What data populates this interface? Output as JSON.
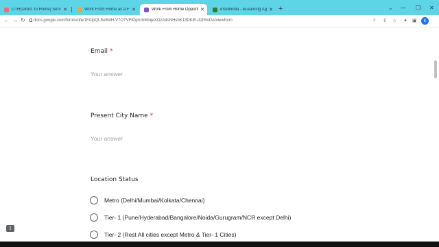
{
  "browser": {
    "tabs": [
      {
        "title": "DTH(Direct To Home) Service Pr...",
        "favicon_color": "#e57373",
        "active": false
      },
      {
        "title": "Work From Home as a Freelance...",
        "favicon_color": "#f6a04d",
        "active": false
      },
      {
        "title": "Work From Home Opportunity...",
        "favicon_color": "#7e57c2",
        "active": true
      },
      {
        "title": "eSkillIndia - eLearning Aggregat...",
        "favicon_color": "#2e7d32",
        "active": false
      }
    ],
    "new_tab_icon": "plus-icon",
    "url": "docs.google.com/forms/d/e/1FAIpQLSei5dH-V7OTVFKfqrUmMojeXOzA4sNHsbK13DKiE-d1h5oDA/viewform",
    "profile_initial": "K"
  },
  "form": {
    "email_label": "Email",
    "required_mark": "*",
    "email_placeholder": "Your answer",
    "city_label": "Present City Name",
    "city_placeholder": "Your answer",
    "location_label": "Location Status",
    "location_options": [
      "Metro (Delhi/Mumbai/Kolkata/Chennai)",
      "Tier- 1 (Pune/Hyderabad/Bangalore/Noida/Gurugram/NCR except Delhi)",
      "Tier- 2 (Rest All cities except Metro & Tier- 1 Cities)"
    ]
  },
  "feedback_icon": "feedback-icon"
}
